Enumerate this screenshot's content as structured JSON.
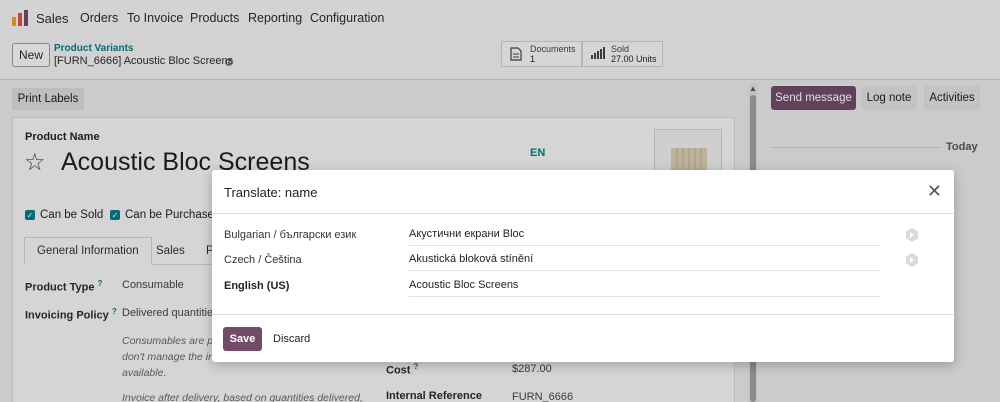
{
  "topnav": {
    "app": "Sales",
    "menu": [
      "Orders",
      "To Invoice",
      "Products",
      "Reporting",
      "Configuration"
    ]
  },
  "control": {
    "new_label": "New",
    "breadcrumb_parent": "Product Variants",
    "breadcrumb_current": "[FURN_6666] Acoustic Bloc Screens",
    "stats": [
      {
        "label": "Documents",
        "value": "1",
        "icon": "document-icon"
      },
      {
        "label": "Sold",
        "value": "27.00 Units",
        "icon": "bar-chart-icon"
      }
    ]
  },
  "form": {
    "print_labels": "Print Labels",
    "product_name_label": "Product Name",
    "product_name": "Acoustic Bloc Screens",
    "lang_badge": "EN",
    "can_be_sold": "Can be Sold",
    "can_be_purchased": "Can be Purchased",
    "tabs": [
      "General Information",
      "Sales",
      "P"
    ],
    "product_type_label": "Product Type",
    "product_type_value": "Consumable",
    "invoicing_policy_label": "Invoicing Policy",
    "invoicing_policy_value": "Delivered quantities",
    "help_text_1a": "Consumables are pr",
    "help_text_1b": "don't manage the in",
    "help_text_1c": "available.",
    "help_text_2": "Invoice after delivery, based on quantities delivered,",
    "cost_label": "Cost",
    "cost_value": "$287.00",
    "internal_ref_label": "Internal Reference",
    "internal_ref_value": "FURN_6666"
  },
  "chatter": {
    "send_message": "Send message",
    "log_note": "Log note",
    "activities": "Activities",
    "today": "Today"
  },
  "modal": {
    "title": "Translate: name",
    "rows": [
      {
        "lang": "Bulgarian / български език",
        "value": "Акустични екрани Bloc"
      },
      {
        "lang": "Czech / Čeština",
        "value": "Akustická bloková stínění"
      },
      {
        "lang": "English (US)",
        "value": "Acoustic Bloc Screens"
      }
    ],
    "save": "Save",
    "discard": "Discard"
  },
  "colors": {
    "primary": "#714b67",
    "accent": "#017e84"
  }
}
